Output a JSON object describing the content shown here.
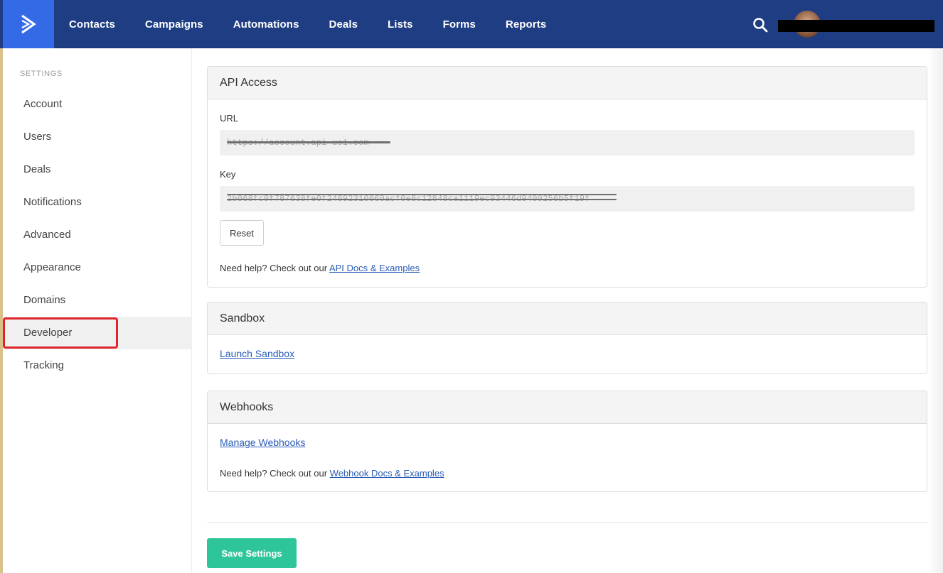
{
  "topnav": {
    "items": [
      "Contacts",
      "Campaigns",
      "Automations",
      "Deals",
      "Lists",
      "Forms",
      "Reports"
    ]
  },
  "sidebar": {
    "heading": "SETTINGS",
    "items": [
      {
        "label": "Account"
      },
      {
        "label": "Users"
      },
      {
        "label": "Deals"
      },
      {
        "label": "Notifications"
      },
      {
        "label": "Advanced"
      },
      {
        "label": "Appearance"
      },
      {
        "label": "Domains"
      },
      {
        "label": "Developer"
      },
      {
        "label": "Tracking"
      }
    ],
    "active": "Developer"
  },
  "api_access": {
    "title": "API Access",
    "url_label": "URL",
    "url_value": "https://account.api-us1.com",
    "key_label": "Key",
    "key_value": "2b068fc0f787638fe0f24892310060acf0e8c12848ca1119ec93446d9400256b5f19f",
    "reset_label": "Reset",
    "help_text": "Need help? Check out our ",
    "help_link": "API Docs & Examples"
  },
  "sandbox": {
    "title": "Sandbox",
    "link": "Launch Sandbox"
  },
  "webhooks": {
    "title": "Webhooks",
    "link": "Manage Webhooks",
    "help_text": "Need help? Check out our ",
    "help_link": "Webhook Docs & Examples"
  },
  "save_label": "Save Settings",
  "colors": {
    "topbar": "#1e3d83",
    "logo_bg": "#356ae6",
    "save_button": "#2fc59a",
    "link": "#2a5db8",
    "active_outline": "#e0252a"
  }
}
